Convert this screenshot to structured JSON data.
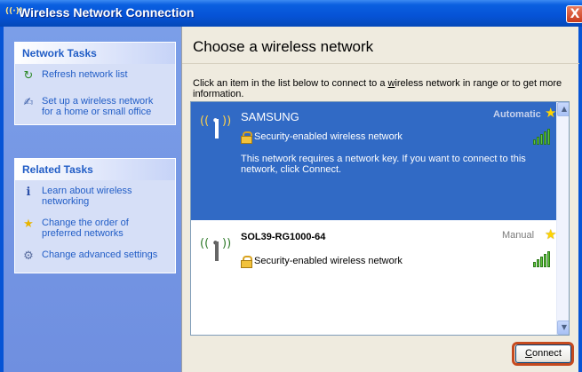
{
  "window": {
    "title": "Wireless Network Connection",
    "title_icon": "wireless-icon",
    "close_label": "X"
  },
  "network_tasks": {
    "heading": "Network Tasks",
    "items": [
      {
        "label": "Refresh network list",
        "icon": "refresh-icon"
      },
      {
        "label": "Set up a wireless network for a home or small office",
        "icon": "setup-icon"
      }
    ]
  },
  "related_tasks": {
    "heading": "Related Tasks",
    "items": [
      {
        "label": "Learn about wireless networking",
        "icon": "info-icon"
      },
      {
        "label": "Change the order of preferred networks",
        "icon": "star-icon"
      },
      {
        "label": "Change advanced settings",
        "icon": "settings-icon"
      }
    ]
  },
  "main": {
    "title": "Choose a wireless network",
    "instructions_prefix": "Click an item in the list below to connect to a ",
    "instructions_link": "w",
    "instructions_link_rest": "ireless network in range or to get more information."
  },
  "networks": [
    {
      "name": "SAMSUNG",
      "mode": "Automatic",
      "security": "Security-enabled wireless network",
      "description": "This network requires a network key. If you want to connect to this network, click Connect.",
      "selected": true,
      "signal_bars": 5
    },
    {
      "name": "SOL39-RG1000-64",
      "mode": "Manual",
      "security": "Security-enabled wireless network",
      "selected": false,
      "signal_bars": 5
    }
  ],
  "buttons": {
    "connect_accel": "C",
    "connect_rest": "onnect"
  },
  "colors": {
    "title_bar": "#0653d6",
    "selected_row": "#316ac5",
    "task_link": "#215dc6",
    "highlight_outline": "#c64a1e"
  }
}
